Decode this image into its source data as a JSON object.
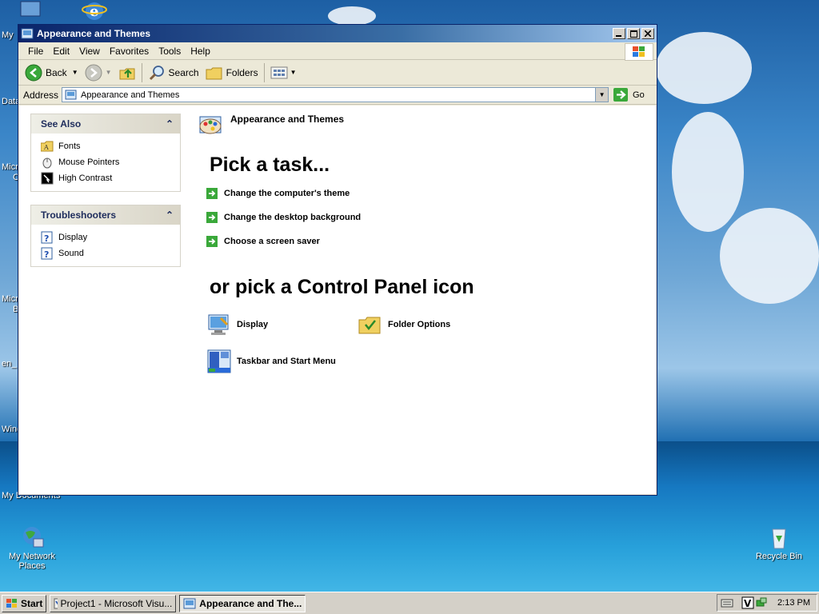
{
  "desktop": {
    "icons": [
      {
        "label": "My Network Places",
        "icon": "network-places-icon"
      },
      {
        "label": "Recycle Bin",
        "icon": "recycle-bin-icon"
      }
    ],
    "edge_labels": [
      "My",
      "Data",
      "Micro",
      "C",
      "Micro",
      "B",
      "en_",
      "Wine",
      "My Documents"
    ]
  },
  "window": {
    "title": "Appearance and Themes",
    "menu": [
      "File",
      "Edit",
      "View",
      "Favorites",
      "Tools",
      "Help"
    ],
    "toolbar": {
      "back": "Back",
      "search": "Search",
      "folders": "Folders"
    },
    "address": {
      "label": "Address",
      "value": "Appearance and Themes",
      "go": "Go"
    }
  },
  "left_pane": {
    "see_also": {
      "title": "See Also",
      "items": [
        {
          "label": "Fonts",
          "icon": "fonts-folder-icon"
        },
        {
          "label": "Mouse Pointers",
          "icon": "mouse-icon"
        },
        {
          "label": "High Contrast",
          "icon": "contrast-icon"
        }
      ]
    },
    "troubleshooters": {
      "title": "Troubleshooters",
      "items": [
        {
          "label": "Display",
          "icon": "help-icon"
        },
        {
          "label": "Sound",
          "icon": "help-icon"
        }
      ]
    }
  },
  "main": {
    "category": "Appearance and Themes",
    "pick_task": "Pick a task...",
    "tasks": [
      "Change the computer's theme",
      "Change the desktop background",
      "Choose a screen saver"
    ],
    "or_pick": "or pick a Control Panel icon",
    "icons": [
      {
        "label": "Display",
        "icon": "display-icon"
      },
      {
        "label": "Folder Options",
        "icon": "folder-options-icon"
      },
      {
        "label": "Taskbar and Start Menu",
        "icon": "taskbar-icon"
      }
    ]
  },
  "taskbar": {
    "start": "Start",
    "tasks": [
      {
        "label": "Project1 - Microsoft Visu...",
        "active": false
      },
      {
        "label": "Appearance and The...",
        "active": true
      }
    ],
    "clock": "2:13 PM"
  },
  "colors": {
    "titlebar": "#0a246a",
    "link_green": "#3a8a3a",
    "heading_blue": "#1e2c5c"
  }
}
